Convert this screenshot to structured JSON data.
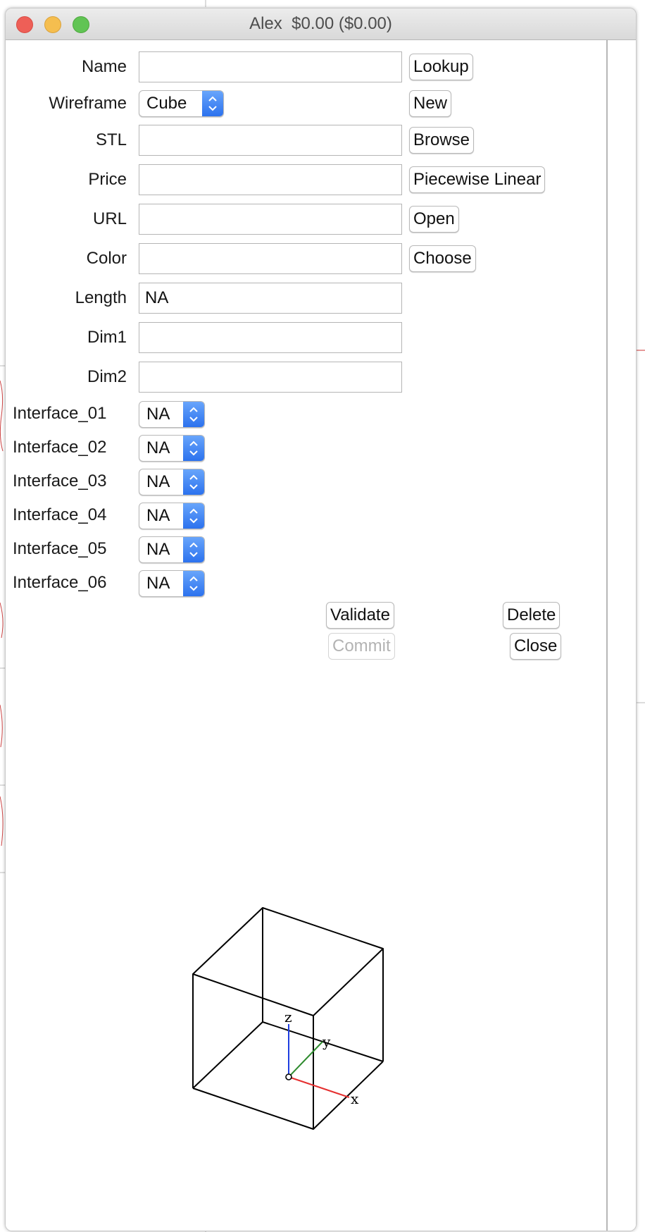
{
  "window": {
    "title": "Alex  $0.00 ($0.00)"
  },
  "form": {
    "fields": {
      "name": {
        "label": "Name",
        "value": ""
      },
      "wireframe": {
        "label": "Wireframe",
        "selected": "Cube"
      },
      "stl": {
        "label": "STL",
        "value": ""
      },
      "price": {
        "label": "Price",
        "value": ""
      },
      "url": {
        "label": "URL",
        "value": ""
      },
      "color": {
        "label": "Color",
        "value": ""
      },
      "length": {
        "label": "Length",
        "value": "NA"
      },
      "dim1": {
        "label": "Dim1",
        "value": ""
      },
      "dim2": {
        "label": "Dim2",
        "value": ""
      }
    },
    "buttons": {
      "lookup": "Lookup",
      "new": "New",
      "browse": "Browse",
      "piecewise_linear": "Piecewise Linear",
      "open": "Open",
      "choose": "Choose",
      "validate": "Validate",
      "delete": "Delete",
      "commit": "Commit",
      "close": "Close"
    },
    "interfaces": [
      {
        "label": "Interface_01",
        "selected": "NA"
      },
      {
        "label": "Interface_02",
        "selected": "NA"
      },
      {
        "label": "Interface_03",
        "selected": "NA"
      },
      {
        "label": "Interface_04",
        "selected": "NA"
      },
      {
        "label": "Interface_05",
        "selected": "NA"
      },
      {
        "label": "Interface_06",
        "selected": "NA"
      }
    ]
  },
  "preview": {
    "shape": "cube-wireframe",
    "axes": {
      "x": "x",
      "y": "y",
      "z": "z"
    },
    "colors": {
      "x_axis": "#e53030",
      "y_axis": "#2e8b2e",
      "z_axis": "#1f3ee0",
      "edges": "#000000"
    }
  },
  "colors": {
    "popup_accent": "#2c72ee",
    "close_light": "#ee5f57",
    "minimize_light": "#f5be4f",
    "zoom_light": "#61c454"
  },
  "icons": [
    "close-icon",
    "minimize-icon",
    "zoom-icon",
    "updown-chevron-icon"
  ]
}
